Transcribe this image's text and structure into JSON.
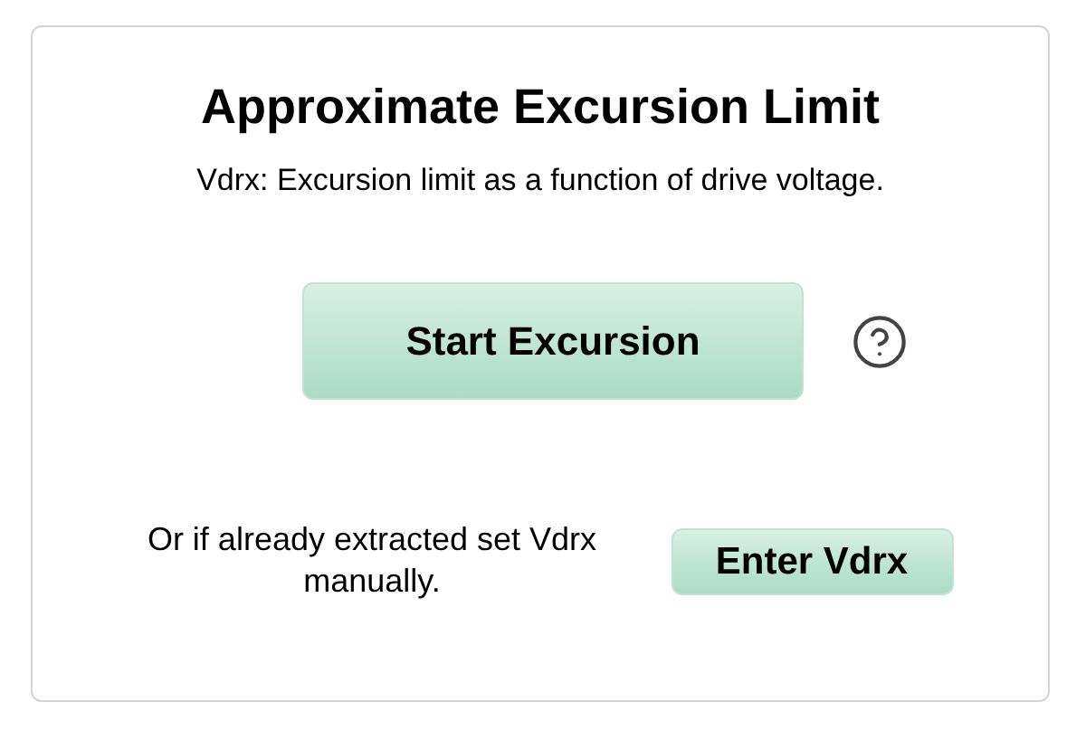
{
  "panel": {
    "title": "Approximate Excursion Limit",
    "subtitle": "Vdrx: Excursion limit as a function of drive voltage.",
    "start_button": "Start Excursion",
    "manual_text": "Or if already extracted set Vdrx manually.",
    "enter_button": "Enter Vdrx"
  }
}
